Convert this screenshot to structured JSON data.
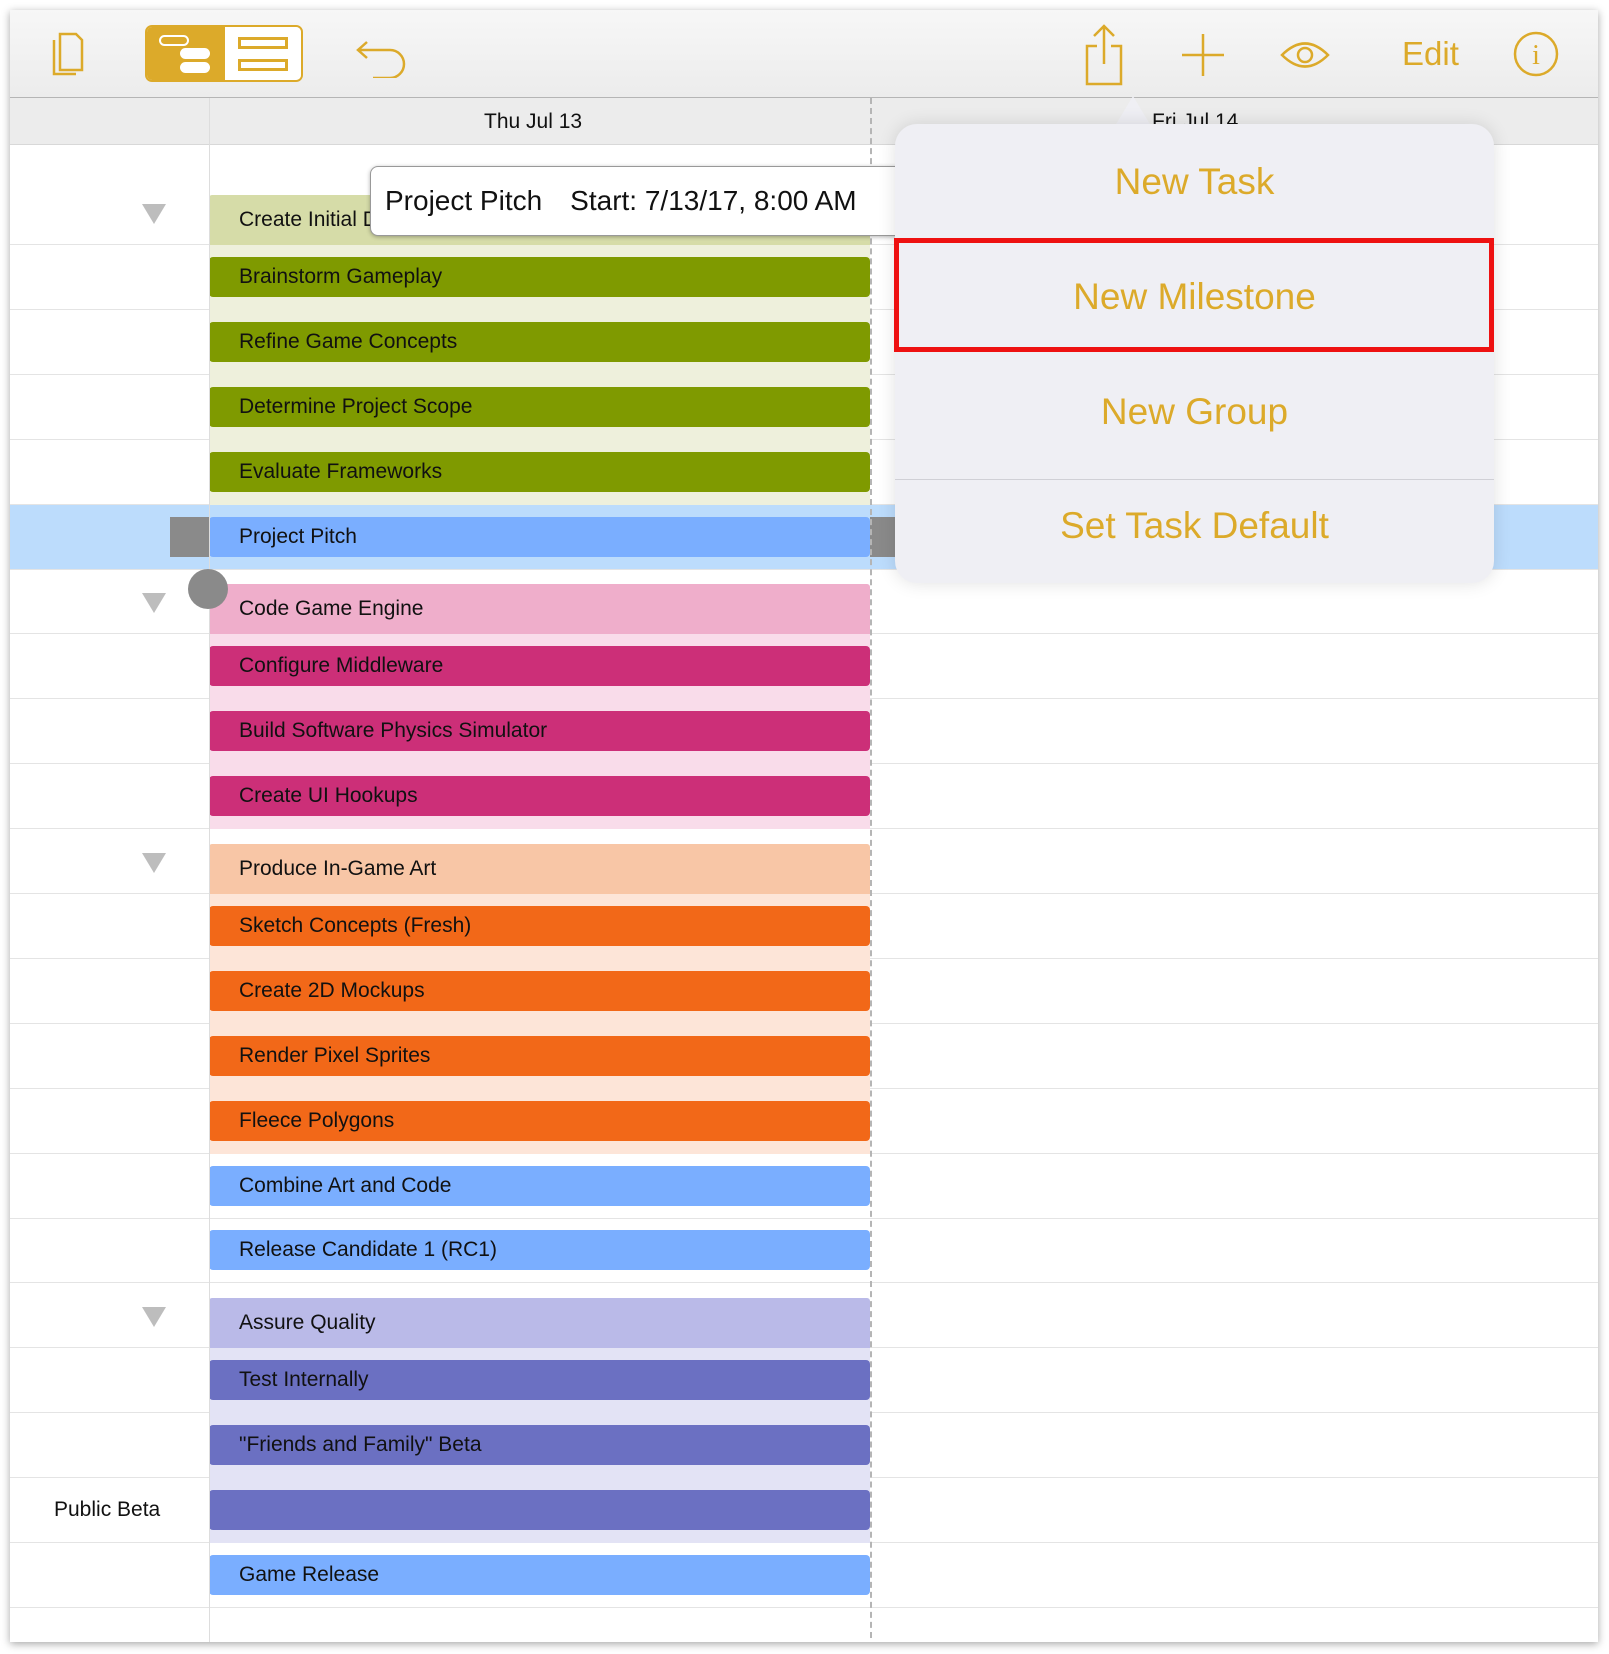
{
  "toolbar": {
    "edit_label": "Edit",
    "icons": [
      "documents-icon",
      "outline-view-icon",
      "network-view-icon",
      "undo-icon",
      "share-icon",
      "add-icon",
      "eye-icon",
      "info-icon"
    ],
    "accent": "#dcaa2a"
  },
  "dates": {
    "day1": "Thu Jul 13",
    "day2": "Fri Jul 14"
  },
  "tooltip": {
    "title": "Project Pitch",
    "start": "Start: 7/13/17, 8:00 AM"
  },
  "popover": {
    "items": [
      "New Task",
      "New Milestone",
      "New Group",
      "Set Task Default"
    ],
    "highlighted": "New Milestone"
  },
  "colors": {
    "green": [
      "#d6dca8",
      "#7f9a00",
      "#eef0dc"
    ],
    "pink": [
      "#efaecb",
      "#cc2f78",
      "#f9dcea"
    ],
    "orange": [
      "#f8c6a6",
      "#f26818",
      "#fde5d8"
    ],
    "blue": [
      "#7aaeff",
      "#7aaeff",
      ""
    ],
    "purple": [
      "#babae8",
      "#6b70c2",
      "#e3e3f5"
    ],
    "selected": "#bcdcfc"
  },
  "rows": [
    {
      "label": "Create Initial Design",
      "kind": "group",
      "color": "green"
    },
    {
      "label": "Brainstorm Gameplay",
      "kind": "task",
      "color": "green"
    },
    {
      "label": "Refine Game Concepts",
      "kind": "task",
      "color": "green"
    },
    {
      "label": "Determine Project Scope",
      "kind": "task",
      "color": "green"
    },
    {
      "label": "Evaluate Frameworks",
      "kind": "task",
      "color": "green"
    },
    {
      "label": "Project Pitch",
      "kind": "task",
      "color": "blue",
      "selected": true
    },
    {
      "label": "Code Game Engine",
      "kind": "group",
      "color": "pink"
    },
    {
      "label": "Configure Middleware",
      "kind": "task",
      "color": "pink"
    },
    {
      "label": "Build Software Physics Simulator",
      "kind": "task",
      "color": "pink"
    },
    {
      "label": "Create UI Hookups",
      "kind": "task",
      "color": "pink"
    },
    {
      "label": "Produce In-Game Art",
      "kind": "group",
      "color": "orange"
    },
    {
      "label": "Sketch Concepts (Fresh)",
      "kind": "task",
      "color": "orange"
    },
    {
      "label": "Create 2D Mockups",
      "kind": "task",
      "color": "orange"
    },
    {
      "label": "Render Pixel Sprites",
      "kind": "task",
      "color": "orange"
    },
    {
      "label": "Fleece Polygons",
      "kind": "task",
      "color": "orange"
    },
    {
      "label": "Combine Art and Code",
      "kind": "task",
      "color": "blue"
    },
    {
      "label": "Release Candidate 1 (RC1)",
      "kind": "task",
      "color": "blue"
    },
    {
      "label": "Assure Quality",
      "kind": "group",
      "color": "purple"
    },
    {
      "label": "Test Internally",
      "kind": "task",
      "color": "purple"
    },
    {
      "label": "\"Friends and Family\" Beta",
      "kind": "task",
      "color": "purple"
    },
    {
      "label": "",
      "left_label": "Public Beta",
      "kind": "task",
      "color": "purple"
    },
    {
      "label": "Game Release",
      "kind": "task",
      "color": "blue"
    }
  ]
}
